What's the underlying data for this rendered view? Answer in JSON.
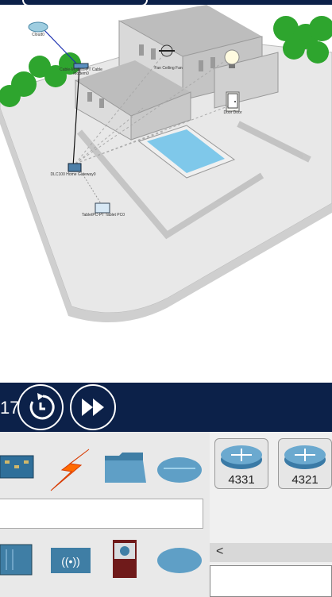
{
  "simulation": {
    "time_fragment": "17"
  },
  "workspace_labels": {
    "cloud": "Cloud0",
    "cable_modem": "Cable-Modem-PT Cable Modem0",
    "ceiling_fan": "Fan Ceiling Fan",
    "light": "",
    "door": "Door Door",
    "home_gateway": "DLC100 Home Gateway0",
    "tablet": "TabletPC-PT Tablet PC0"
  },
  "device_models": [
    "4331",
    "4321"
  ],
  "colors": {
    "nav": "#0c2149",
    "panel": "#e9e9e9",
    "pool": "#7fc8ea",
    "grass": "#2ea52e"
  },
  "icons": [
    "reset-icon",
    "fast-forward-icon",
    "board-icon",
    "lightning-icon",
    "folder-icon",
    "cloud-icon",
    "server-rack-icon",
    "wireless-icon",
    "custom-device-icon",
    "cloud-icon",
    "router-icon"
  ]
}
